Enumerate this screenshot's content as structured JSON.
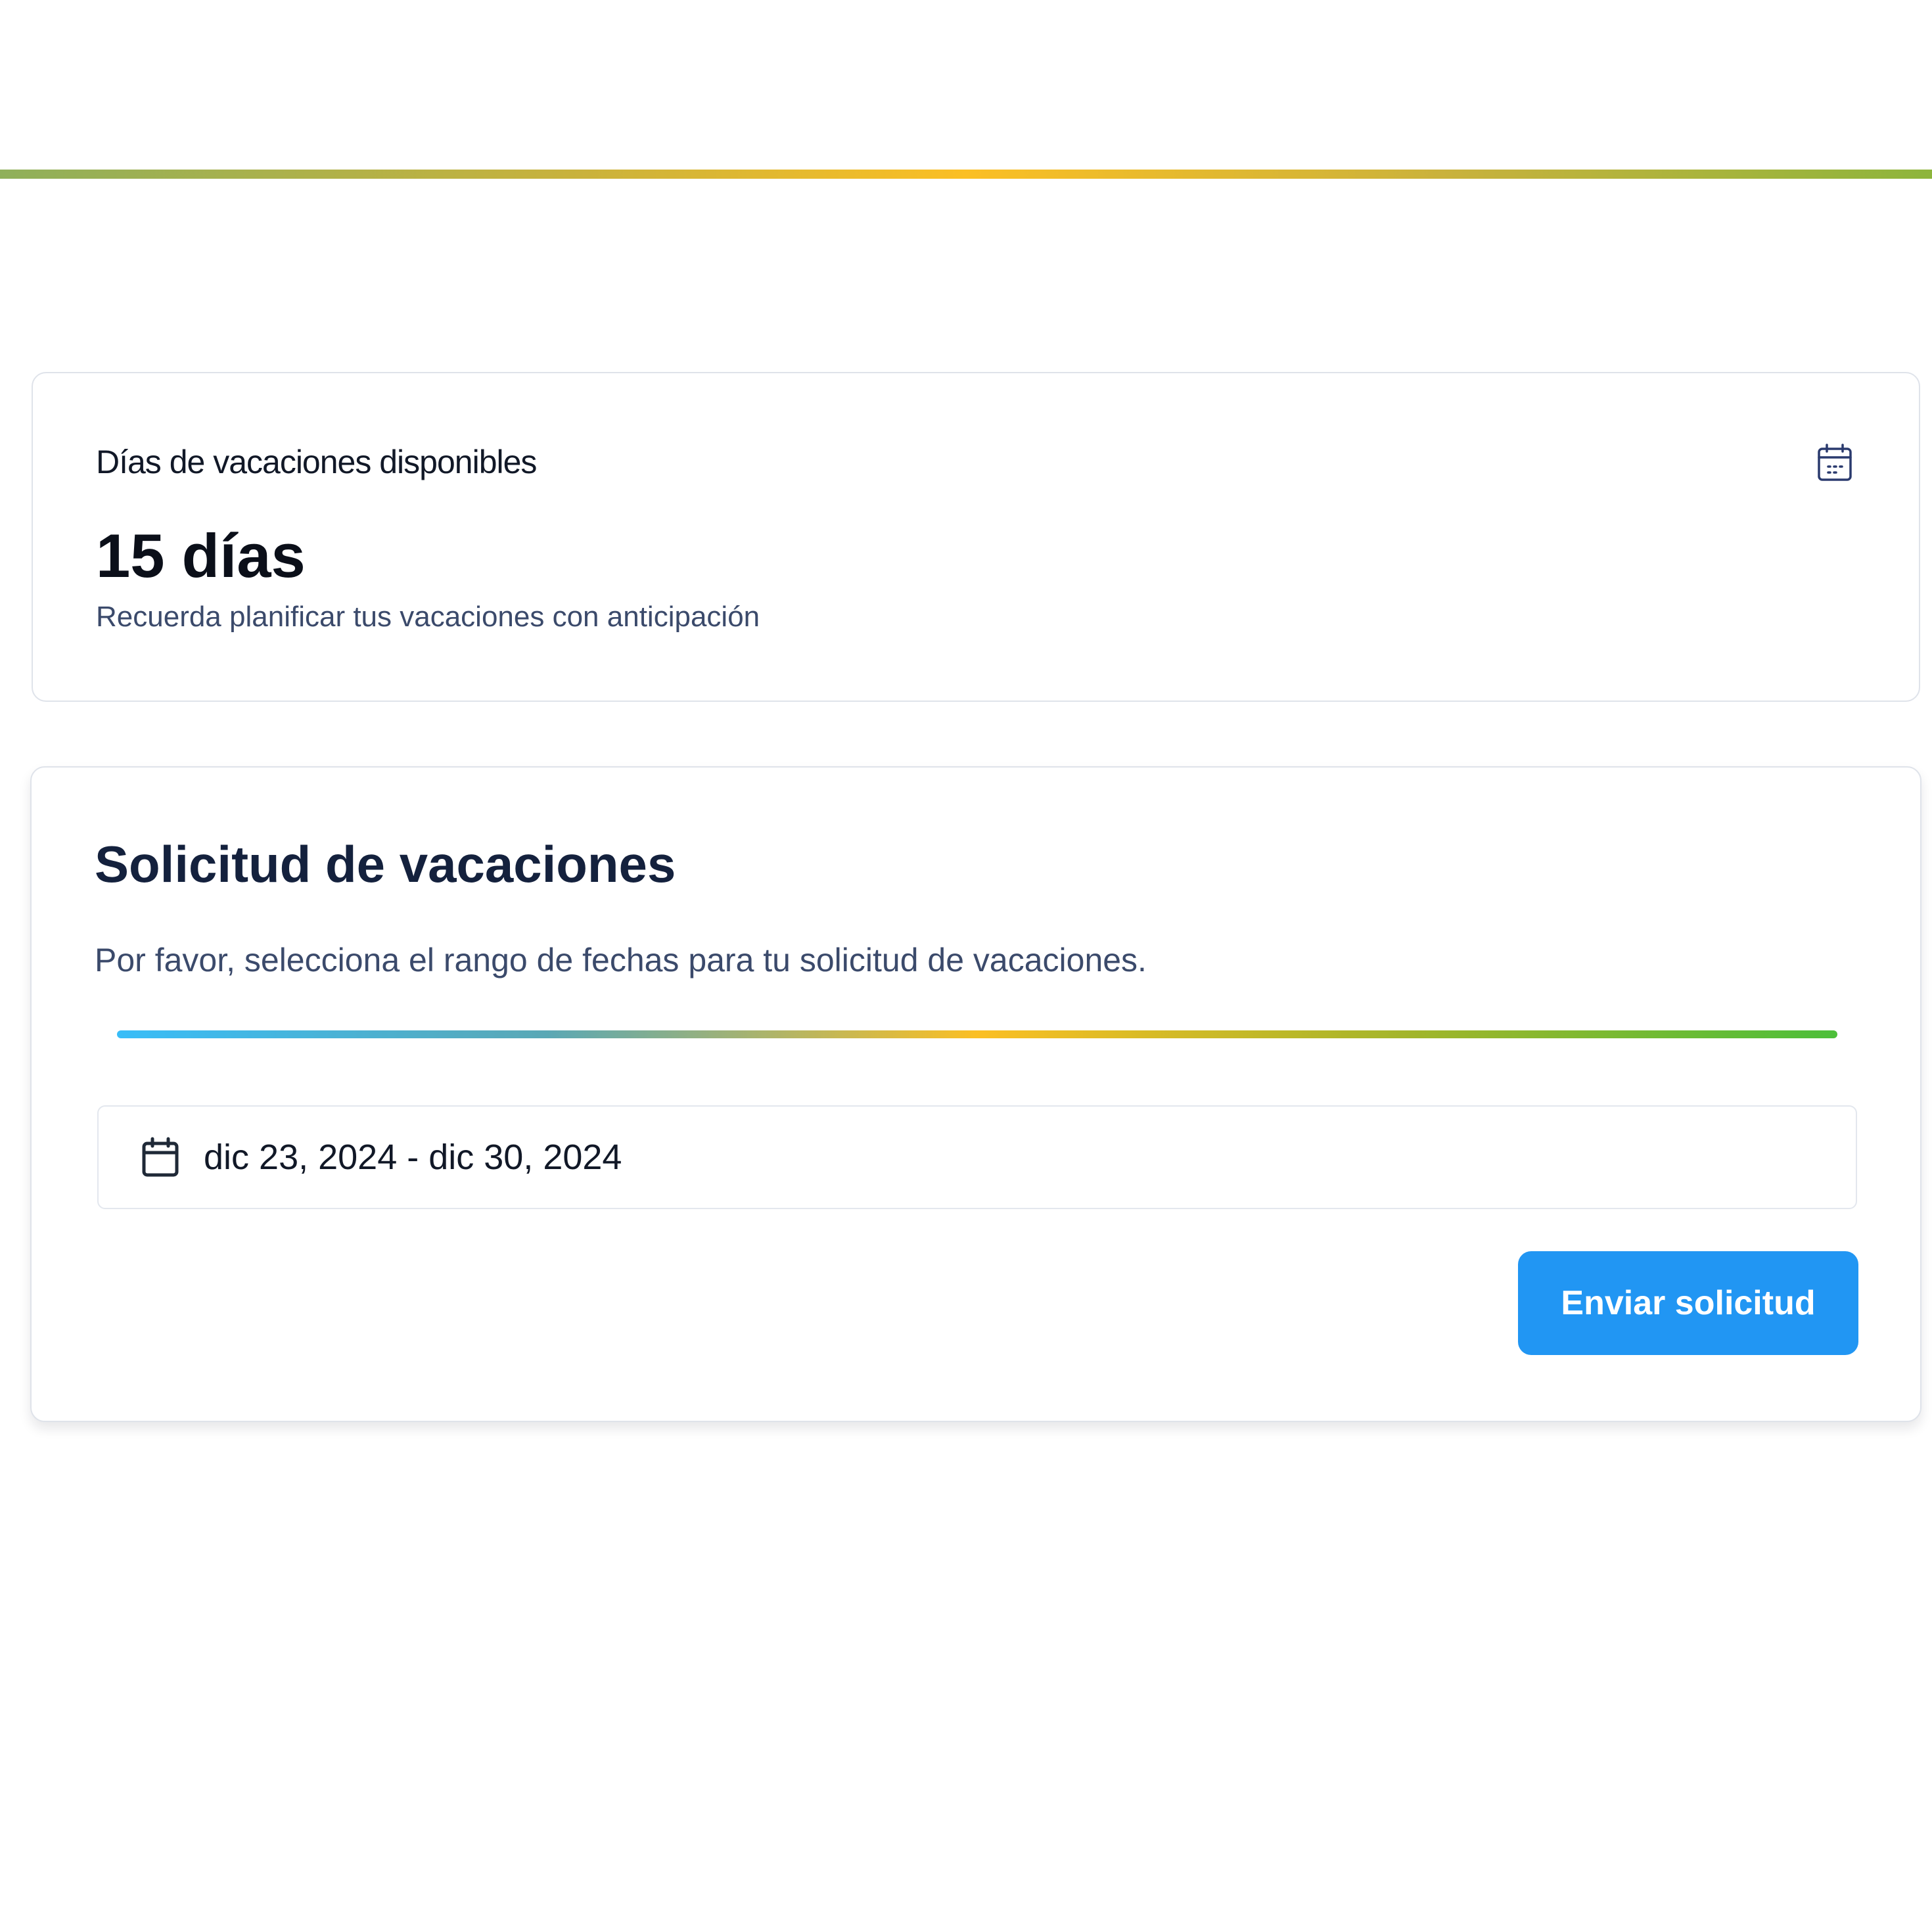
{
  "header": {
    "accent_colors": [
      "#8fb05a",
      "#fbbf24",
      "#8db53c"
    ]
  },
  "balance_card": {
    "label": "Días de vacaciones disponibles",
    "value": "15 días",
    "hint": "Recuerda planificar tus vacaciones con anticipación",
    "icon": "calendar-icon"
  },
  "request_card": {
    "title": "Solicitud de vacaciones",
    "description": "Por favor, selecciona el rango de fechas para tu solicitud de vacaciones.",
    "progress_colors": [
      "#38bdf8",
      "#fbbf24",
      "#4cbf3a"
    ],
    "date_range": {
      "icon": "calendar-icon",
      "value": "dic 23, 2024 - dic 30, 2024"
    },
    "submit_label": "Enviar solicitud",
    "submit_color": "#2196f3"
  }
}
